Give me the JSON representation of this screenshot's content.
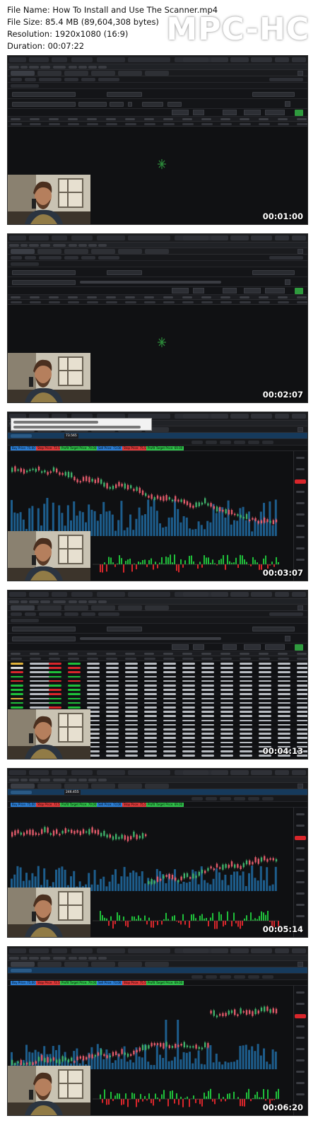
{
  "file_info": {
    "file_name": "File Name: How To Install and Use The Scanner.mp4",
    "file_size": "File Size: 85.4 MB (89,604,308 bytes)",
    "resolution": "Resolution: 1920x1080 (16:9)",
    "duration": "Duration: 00:07:22"
  },
  "brand": "MPC-HC",
  "frames": [
    {
      "timestamp": "00:01:00",
      "view": "scanner-empty"
    },
    {
      "timestamp": "00:02:07",
      "view": "scanner-empty"
    },
    {
      "timestamp": "00:03:07",
      "view": "chart-bars"
    },
    {
      "timestamp": "00:04:13",
      "view": "scanner-results"
    },
    {
      "timestamp": "00:05:14",
      "view": "chart-candles"
    },
    {
      "timestamp": "00:06:20",
      "view": "chart-spike"
    }
  ],
  "chart_labels": {
    "f3_price": "73.565",
    "f5_price": "246.455",
    "signal_buy": "Buy Price: 75.00",
    "signal_stop": "Stop Price: 72.50",
    "signal_t1": "Profit Target Price: 79.00",
    "signal_sell": "Sell Price: 73.00",
    "signal_stop2": "Stop Price: 75.50",
    "signal_t2": "Profit Target Price: 69.00"
  },
  "colors": {
    "frame_bg": "#111214",
    "green_bar": "#1fbf3a",
    "red_bar": "#d9262b",
    "blue_vol": "#1d5d8c",
    "candle_red": "#e05a6a",
    "candle_green": "#3fb06a"
  }
}
